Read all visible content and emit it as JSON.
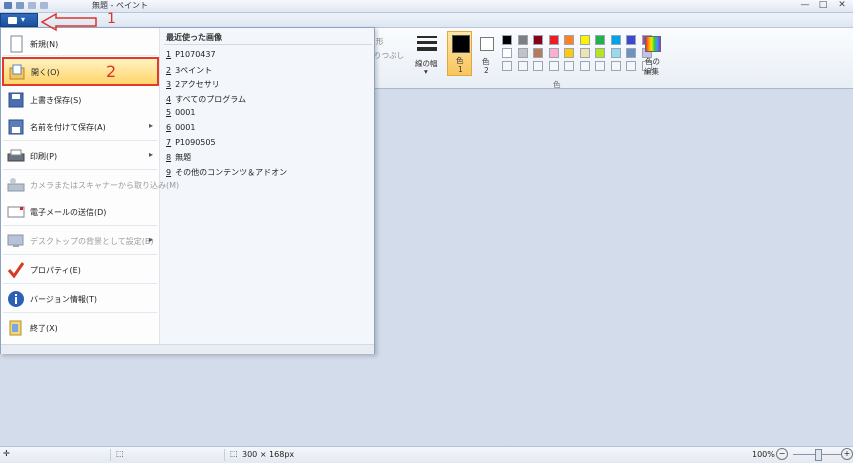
{
  "window": {
    "title": "無題 - ペイント",
    "minimize": "—",
    "maximize": "□",
    "close": "✕"
  },
  "ribbon": {
    "partial_label_1": "形",
    "partial_label_2": "りつぶし",
    "line_width_label": "線の幅",
    "color1_label": "色",
    "color1_num": "1",
    "color2_label": "色",
    "color2_num": "2",
    "edit_colors_label_1": "色の",
    "edit_colors_label_2": "編集",
    "colors_group_label": "色",
    "palette_row1": [
      "#000000",
      "#7f7f7f",
      "#880015",
      "#ed1c24",
      "#ff7f27",
      "#fff200",
      "#22b14c",
      "#00a2e8",
      "#3f48cc",
      "#a349a4"
    ],
    "palette_row2": [
      "#ffffff",
      "#c3c3c3",
      "#b97a57",
      "#ffaec9",
      "#ffc90e",
      "#efe4b0",
      "#b5e61d",
      "#99d9ea",
      "#7092be",
      "#c8bfe7"
    ]
  },
  "file_menu": {
    "items": [
      {
        "label": "新規(N)",
        "icon": "new-file-icon",
        "disabled": false,
        "submenu": false
      },
      {
        "label": "開く(O)",
        "icon": "open-folder-icon",
        "disabled": false,
        "submenu": false
      },
      {
        "label": "上書き保存(S)",
        "icon": "save-icon",
        "disabled": false,
        "submenu": false
      },
      {
        "label": "名前を付けて保存(A)",
        "icon": "save-as-icon",
        "disabled": false,
        "submenu": true
      },
      {
        "label": "印刷(P)",
        "icon": "printer-icon",
        "disabled": false,
        "submenu": true
      },
      {
        "label": "カメラまたはスキャナーから取り込み(M)",
        "icon": "scanner-icon",
        "disabled": true,
        "submenu": false
      },
      {
        "label": "電子メールの送信(D)",
        "icon": "email-icon",
        "disabled": false,
        "submenu": false
      },
      {
        "label": "デスクトップの背景として設定(B)",
        "icon": "desktop-icon",
        "disabled": true,
        "submenu": true
      },
      {
        "label": "プロパティ(E)",
        "icon": "checkmark-icon",
        "disabled": false,
        "submenu": false
      },
      {
        "label": "バージョン情報(T)",
        "icon": "info-icon",
        "disabled": false,
        "submenu": false
      },
      {
        "label": "終了(X)",
        "icon": "exit-icon",
        "disabled": false,
        "submenu": false
      }
    ],
    "submenu_arrow": "▸",
    "recent_title": "最近使った画像",
    "recent": [
      {
        "num": "1",
        "name": "P1070437"
      },
      {
        "num": "2",
        "name": "3ペイント"
      },
      {
        "num": "3",
        "name": "2アクセサリ"
      },
      {
        "num": "4",
        "name": "すべてのプログラム"
      },
      {
        "num": "5",
        "name": "0001"
      },
      {
        "num": "6",
        "name": "0001"
      },
      {
        "num": "7",
        "name": "P1090505"
      },
      {
        "num": "8",
        "name": "無題"
      },
      {
        "num": "9",
        "name": "その他のコンテンツ＆アドオン"
      }
    ]
  },
  "annotations": {
    "step1": "1",
    "step2": "2"
  },
  "statusbar": {
    "move_icon": "✛",
    "select_icon": "⬚",
    "canvas_size": "300 × 168px",
    "zoom": "100%",
    "zoom_minus": "−",
    "zoom_plus": "+"
  },
  "colors": {
    "accent_red": "#e0342a",
    "highlight": "#ffd56b"
  }
}
